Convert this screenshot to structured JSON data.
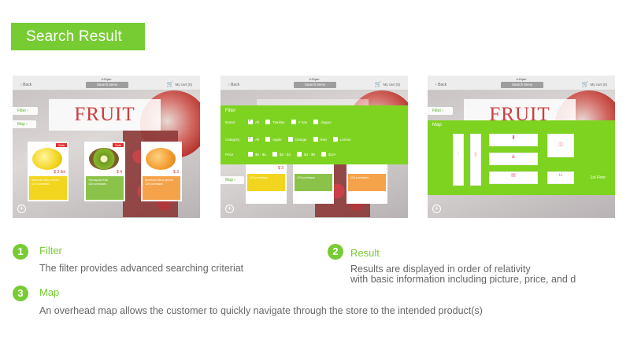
{
  "banner": {
    "title": "Search Result"
  },
  "app": {
    "time": "4:11pm",
    "back": "Back",
    "search": "Search items",
    "cart": "My cart (0)",
    "hero": "FRUIT",
    "side_filter": "Filter",
    "side_map": "Map"
  },
  "products": [
    {
      "name": "Lemon",
      "price": "$ 3 /kit",
      "sale": "Sale",
      "info": "American citrus lemon",
      "stock": "124 purchases",
      "color": "#f2d51e"
    },
    {
      "name": "Kiwi",
      "price": "$ 4",
      "sale": "Sale",
      "info": "Yuhuayuan Kiwi",
      "stock": "123 purchases",
      "color": "#8bc34a"
    },
    {
      "name": "Apricot",
      "price": "$ 3",
      "sale": "",
      "info": "American citrus apricot",
      "stock": "120 purchases",
      "color": "#f5a34a"
    }
  ],
  "filter": {
    "title": "Filter",
    "brand_label": "Brand",
    "brand_options": [
      "All",
      "Tianlian",
      "Y hao",
      "Jiaguo"
    ],
    "category_label": "Category",
    "category_options": [
      "All",
      "Apple",
      "Orange",
      "Kiwi",
      "Lemon"
    ],
    "price_label": "Price",
    "price_options": [
      "$0 - $1",
      "$2 - $3",
      "$4 - $9",
      "$10+"
    ],
    "shot2_price": "$ 3",
    "shot2_info": "123 purchases"
  },
  "map": {
    "title": "Map",
    "floor": "1st Floor"
  },
  "features": [
    {
      "num": "1",
      "title": "Filter",
      "desc": "The filter provides advanced searching criteriat"
    },
    {
      "num": "2",
      "title": "Result",
      "desc": "Results are displayed in order of relativity",
      "desc2": "with basic information including picture, price, and d"
    },
    {
      "num": "3",
      "title": "Map",
      "desc": "An overhead map allows the customer to quickly navigate through the store to the intended product(s)"
    }
  ],
  "colors": {
    "accent": "#77cc33",
    "panel_green": "#7ed321",
    "fruit_red": "#cc3d3d"
  }
}
